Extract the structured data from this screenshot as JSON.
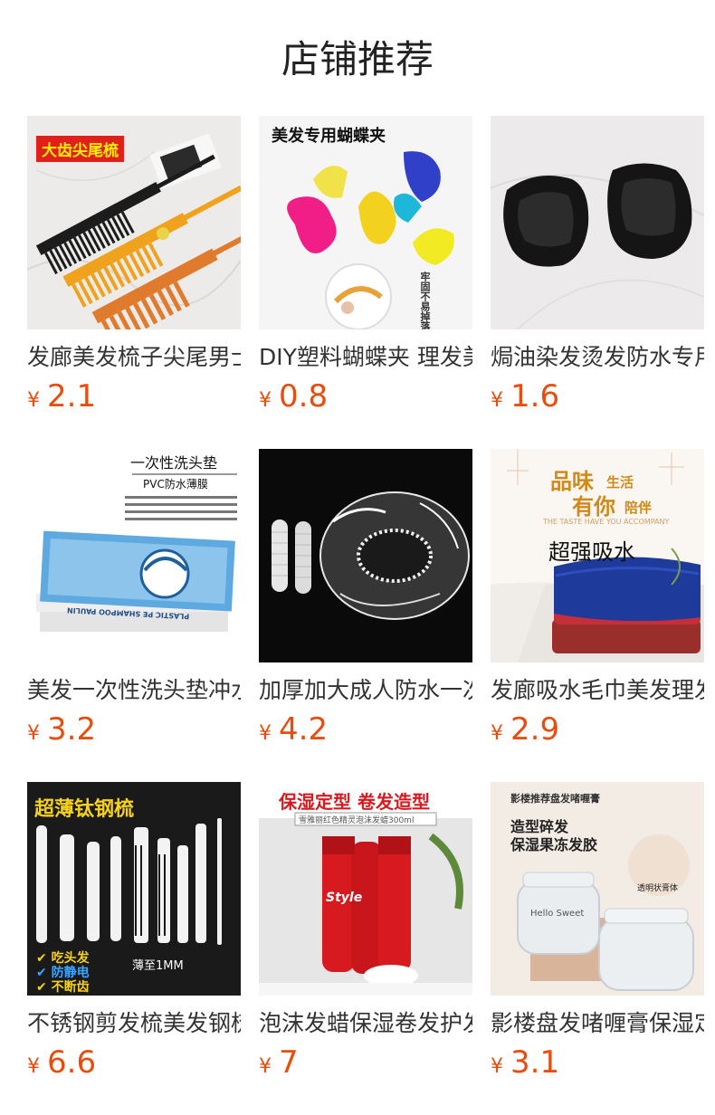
{
  "header": {
    "title": "店铺推荐"
  },
  "currency": "¥",
  "products": [
    {
      "name": "发廊美发梳子尖尾男士",
      "price": "2.1",
      "tags": [
        "大齿尖尾梳"
      ]
    },
    {
      "name": "DIY塑料蝴蝶夹 理发美",
      "price": "0.8",
      "tags": [
        "美发专用蝴蝶夹",
        "牢固不易掉落"
      ]
    },
    {
      "name": "焗油染发烫发防水专用",
      "price": "1.6",
      "tags": []
    },
    {
      "name": "美发一次性洗头垫冲水",
      "price": "3.2",
      "tags": [
        "一次性洗头垫",
        "PVC防水薄膜",
        "PLASTIC PE SHAMPOO PAULIN"
      ]
    },
    {
      "name": "加厚加大成人防水一次",
      "price": "4.2",
      "tags": []
    },
    {
      "name": "发廊吸水毛巾美发理发",
      "price": "2.9",
      "tags": [
        "品味",
        "生活",
        "有你",
        "陪伴",
        "THE TASTE HAVE YOU ACCOMPANY",
        "超强吸水"
      ]
    },
    {
      "name": "不锈钢剪发梳美发钢梳",
      "price": "6.6",
      "tags": [
        "超薄钛钢梳",
        "✔ 吃头发",
        "✔ 防静电",
        "✔ 不断齿",
        "薄至1MM"
      ]
    },
    {
      "name": "泡沫发蜡保湿卷发护发",
      "price": "7",
      "tags": [
        "保湿定型 卷发造型",
        "雪雅丽红色精灵泡沫发蜡300ml",
        "Style"
      ]
    },
    {
      "name": "影楼盘发啫喱膏保湿定",
      "price": "3.1",
      "tags": [
        "影楼推荐盘发啫喱膏",
        "造型碎发",
        "保湿果冻发胶",
        "透明状膏体",
        "Hello Sweet"
      ]
    }
  ]
}
